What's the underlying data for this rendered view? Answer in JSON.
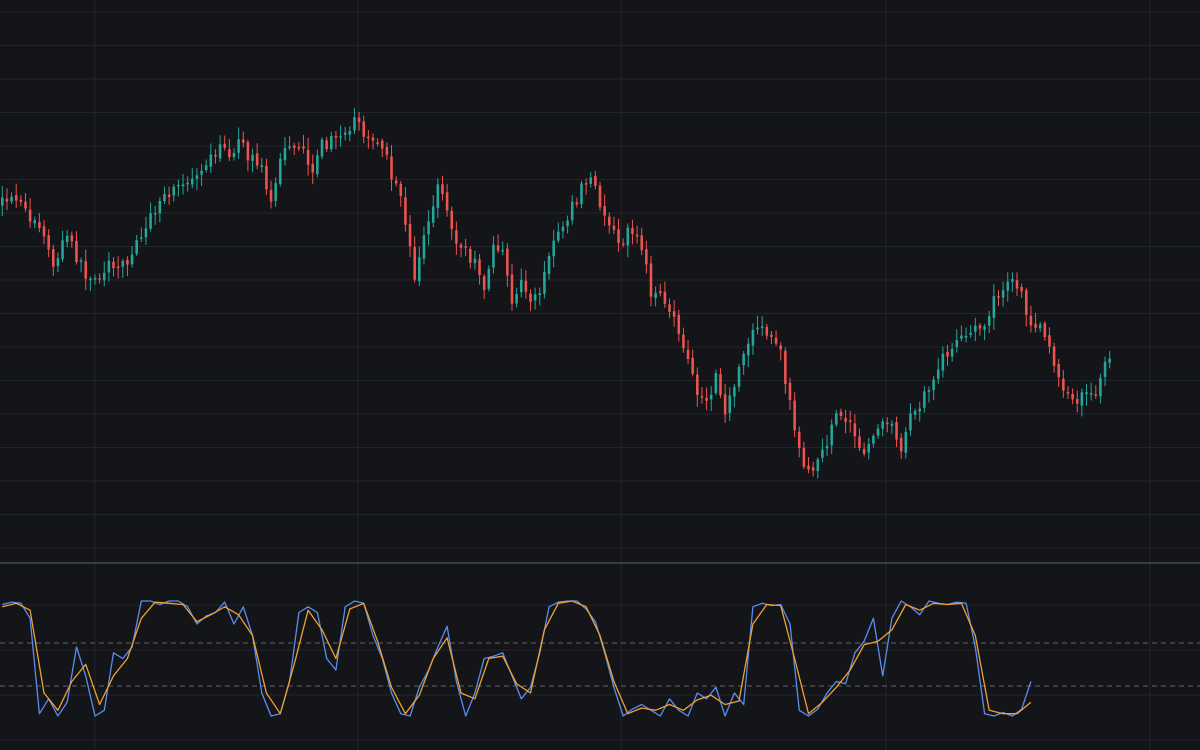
{
  "theme": {
    "background": "#141519",
    "grid": "#22252c",
    "separator": "#3a3d44",
    "up": "#26a69a",
    "down": "#ef5350",
    "k_line": "#5b8def",
    "d_line": "#f0a030",
    "level_line": "#5f636b"
  },
  "chart_data": [
    {
      "type": "candlestick",
      "panel": "price",
      "price_anchors": [
        [
          0,
          205
        ],
        [
          4,
          201
        ],
        [
          7,
          218
        ],
        [
          9,
          225
        ],
        [
          12,
          265
        ],
        [
          15,
          236
        ],
        [
          19,
          275
        ],
        [
          22,
          284
        ],
        [
          24,
          260
        ],
        [
          28,
          265
        ],
        [
          31,
          232
        ],
        [
          35,
          205
        ],
        [
          37,
          194
        ],
        [
          41,
          180
        ],
        [
          44,
          165
        ],
        [
          47,
          150
        ],
        [
          50,
          152
        ],
        [
          52,
          142
        ],
        [
          54,
          155
        ],
        [
          57,
          170
        ],
        [
          59,
          195
        ],
        [
          62,
          148
        ],
        [
          66,
          152
        ],
        [
          68,
          178
        ],
        [
          70,
          145
        ],
        [
          72,
          142
        ],
        [
          74,
          130
        ],
        [
          77,
          122
        ],
        [
          79,
          130
        ],
        [
          81,
          140
        ],
        [
          83,
          150
        ],
        [
          86,
          185
        ],
        [
          88,
          220
        ],
        [
          90,
          275
        ],
        [
          93,
          220
        ],
        [
          95,
          190
        ],
        [
          97,
          210
        ],
        [
          99,
          245
        ],
        [
          101,
          250
        ],
        [
          103,
          265
        ],
        [
          105,
          290
        ],
        [
          107,
          245
        ],
        [
          109,
          255
        ],
        [
          111,
          305
        ],
        [
          113,
          280
        ],
        [
          115,
          300
        ],
        [
          117,
          295
        ],
        [
          119,
          255
        ],
        [
          121,
          230
        ],
        [
          123,
          215
        ],
        [
          125,
          200
        ],
        [
          127,
          178
        ],
        [
          129,
          190
        ],
        [
          131,
          215
        ],
        [
          133,
          232
        ],
        [
          135,
          240
        ],
        [
          137,
          228
        ],
        [
          139,
          250
        ],
        [
          141,
          290
        ],
        [
          143,
          300
        ],
        [
          145,
          315
        ],
        [
          147,
          330
        ],
        [
          149,
          365
        ],
        [
          151,
          395
        ],
        [
          153,
          405
        ],
        [
          155,
          380
        ],
        [
          157,
          410
        ],
        [
          159,
          390
        ],
        [
          161,
          355
        ],
        [
          163,
          330
        ],
        [
          165,
          328
        ],
        [
          167,
          335
        ],
        [
          169,
          355
        ],
        [
          171,
          400
        ],
        [
          173,
          450
        ],
        [
          175,
          475
        ],
        [
          177,
          455
        ],
        [
          179,
          440
        ],
        [
          181,
          420
        ],
        [
          183,
          415
        ],
        [
          185,
          440
        ],
        [
          187,
          460
        ],
        [
          189,
          430
        ],
        [
          191,
          420
        ],
        [
          193,
          430
        ],
        [
          195,
          445
        ],
        [
          197,
          420
        ],
        [
          199,
          405
        ],
        [
          201,
          390
        ],
        [
          203,
          370
        ],
        [
          205,
          350
        ],
        [
          207,
          342
        ],
        [
          209,
          340
        ],
        [
          211,
          328
        ],
        [
          213,
          320
        ],
        [
          215,
          300
        ],
        [
          217,
          292
        ],
        [
          219,
          280
        ],
        [
          221,
          292
        ],
        [
          223,
          330
        ],
        [
          225,
          318
        ],
        [
          227,
          345
        ],
        [
          229,
          382
        ],
        [
          231,
          395
        ],
        [
          233,
          405
        ],
        [
          235,
          390
        ],
        [
          237,
          395
        ],
        [
          239,
          360
        ]
      ],
      "x_range": [
        0,
        239
      ],
      "y_range": [
        100,
        510
      ],
      "grid": true
    },
    {
      "type": "line",
      "panel": "oscillator",
      "series": [
        {
          "key": "k",
          "anchors": [
            [
              0,
              0.97
            ],
            [
              2,
              0.99
            ],
            [
              4,
              0.98
            ],
            [
              6,
              0.85
            ],
            [
              8,
              0.02
            ],
            [
              10,
              0.15
            ],
            [
              12,
              0.0
            ],
            [
              14,
              0.12
            ],
            [
              16,
              0.6
            ],
            [
              18,
              0.35
            ],
            [
              20,
              0.0
            ],
            [
              22,
              0.05
            ],
            [
              24,
              0.55
            ],
            [
              26,
              0.5
            ],
            [
              28,
              0.6
            ],
            [
              30,
              1.0
            ],
            [
              32,
              1.0
            ],
            [
              34,
              0.97
            ],
            [
              36,
              1.0
            ],
            [
              38,
              1.0
            ],
            [
              40,
              0.95
            ],
            [
              42,
              0.8
            ],
            [
              44,
              0.87
            ],
            [
              46,
              0.9
            ],
            [
              48,
              0.99
            ],
            [
              50,
              0.8
            ],
            [
              52,
              0.95
            ],
            [
              54,
              0.7
            ],
            [
              56,
              0.2
            ],
            [
              58,
              0.0
            ],
            [
              60,
              0.02
            ],
            [
              62,
              0.3
            ],
            [
              64,
              0.9
            ],
            [
              66,
              0.95
            ],
            [
              68,
              0.9
            ],
            [
              70,
              0.5
            ],
            [
              72,
              0.4
            ],
            [
              74,
              0.95
            ],
            [
              76,
              1.0
            ],
            [
              78,
              0.98
            ],
            [
              80,
              0.7
            ],
            [
              82,
              0.5
            ],
            [
              84,
              0.2
            ],
            [
              86,
              0.02
            ],
            [
              88,
              0.0
            ],
            [
              90,
              0.25
            ],
            [
              92,
              0.4
            ],
            [
              94,
              0.6
            ],
            [
              96,
              0.78
            ],
            [
              98,
              0.3
            ],
            [
              100,
              0.0
            ],
            [
              102,
              0.2
            ],
            [
              104,
              0.5
            ],
            [
              106,
              0.52
            ],
            [
              108,
              0.55
            ],
            [
              110,
              0.35
            ],
            [
              112,
              0.15
            ],
            [
              114,
              0.25
            ],
            [
              116,
              0.55
            ],
            [
              118,
              0.95
            ],
            [
              120,
              0.99
            ],
            [
              122,
              1.0
            ],
            [
              124,
              1.0
            ],
            [
              126,
              0.93
            ],
            [
              128,
              0.82
            ],
            [
              130,
              0.55
            ],
            [
              132,
              0.25
            ],
            [
              134,
              0.0
            ],
            [
              136,
              0.06
            ],
            [
              138,
              0.1
            ],
            [
              140,
              0.05
            ],
            [
              142,
              0.0
            ],
            [
              144,
              0.15
            ],
            [
              146,
              0.05
            ],
            [
              148,
              0.0
            ],
            [
              150,
              0.2
            ],
            [
              152,
              0.15
            ],
            [
              154,
              0.25
            ],
            [
              156,
              0.0
            ],
            [
              158,
              0.2
            ],
            [
              160,
              0.1
            ],
            [
              162,
              0.95
            ],
            [
              164,
              0.98
            ],
            [
              166,
              0.96
            ],
            [
              168,
              0.97
            ],
            [
              170,
              0.8
            ],
            [
              172,
              0.05
            ],
            [
              174,
              0.0
            ],
            [
              176,
              0.06
            ],
            [
              178,
              0.2
            ],
            [
              180,
              0.3
            ],
            [
              182,
              0.28
            ],
            [
              184,
              0.55
            ],
            [
              186,
              0.65
            ],
            [
              188,
              0.85
            ],
            [
              190,
              0.35
            ],
            [
              192,
              0.85
            ],
            [
              194,
              1.0
            ],
            [
              196,
              0.95
            ],
            [
              198,
              0.88
            ],
            [
              200,
              1.0
            ],
            [
              202,
              0.98
            ],
            [
              204,
              0.97
            ],
            [
              206,
              0.99
            ],
            [
              208,
              0.98
            ],
            [
              210,
              0.6
            ],
            [
              212,
              0.02
            ],
            [
              214,
              0.0
            ],
            [
              216,
              0.03
            ],
            [
              218,
              0.0
            ],
            [
              220,
              0.06
            ],
            [
              222,
              0.3
            ]
          ]
        },
        {
          "key": "d",
          "anchors": [
            [
              0,
              0.95
            ],
            [
              3,
              0.98
            ],
            [
              6,
              0.92
            ],
            [
              9,
              0.2
            ],
            [
              12,
              0.05
            ],
            [
              15,
              0.3
            ],
            [
              18,
              0.45
            ],
            [
              21,
              0.1
            ],
            [
              24,
              0.35
            ],
            [
              27,
              0.5
            ],
            [
              30,
              0.85
            ],
            [
              33,
              0.99
            ],
            [
              36,
              0.98
            ],
            [
              39,
              0.97
            ],
            [
              42,
              0.82
            ],
            [
              45,
              0.88
            ],
            [
              48,
              0.95
            ],
            [
              51,
              0.88
            ],
            [
              54,
              0.7
            ],
            [
              57,
              0.2
            ],
            [
              60,
              0.02
            ],
            [
              63,
              0.45
            ],
            [
              66,
              0.92
            ],
            [
              69,
              0.75
            ],
            [
              72,
              0.5
            ],
            [
              75,
              0.93
            ],
            [
              78,
              0.98
            ],
            [
              81,
              0.65
            ],
            [
              84,
              0.25
            ],
            [
              87,
              0.02
            ],
            [
              90,
              0.18
            ],
            [
              93,
              0.5
            ],
            [
              96,
              0.68
            ],
            [
              99,
              0.2
            ],
            [
              102,
              0.15
            ],
            [
              105,
              0.5
            ],
            [
              108,
              0.52
            ],
            [
              111,
              0.28
            ],
            [
              114,
              0.2
            ],
            [
              117,
              0.75
            ],
            [
              120,
              0.98
            ],
            [
              123,
              1.0
            ],
            [
              126,
              0.95
            ],
            [
              129,
              0.7
            ],
            [
              132,
              0.3
            ],
            [
              135,
              0.02
            ],
            [
              138,
              0.07
            ],
            [
              141,
              0.05
            ],
            [
              144,
              0.1
            ],
            [
              147,
              0.05
            ],
            [
              150,
              0.14
            ],
            [
              153,
              0.18
            ],
            [
              156,
              0.1
            ],
            [
              159,
              0.13
            ],
            [
              162,
              0.8
            ],
            [
              165,
              0.97
            ],
            [
              168,
              0.96
            ],
            [
              171,
              0.5
            ],
            [
              174,
              0.02
            ],
            [
              177,
              0.12
            ],
            [
              180,
              0.25
            ],
            [
              183,
              0.4
            ],
            [
              186,
              0.62
            ],
            [
              189,
              0.65
            ],
            [
              192,
              0.75
            ],
            [
              195,
              0.97
            ],
            [
              198,
              0.92
            ],
            [
              201,
              0.98
            ],
            [
              204,
              0.97
            ],
            [
              207,
              0.98
            ],
            [
              210,
              0.7
            ],
            [
              213,
              0.05
            ],
            [
              216,
              0.02
            ],
            [
              219,
              0.02
            ],
            [
              222,
              0.12
            ]
          ]
        }
      ],
      "levels": [
        80,
        20
      ],
      "y_range": [
        0,
        100
      ],
      "grid": true
    }
  ]
}
